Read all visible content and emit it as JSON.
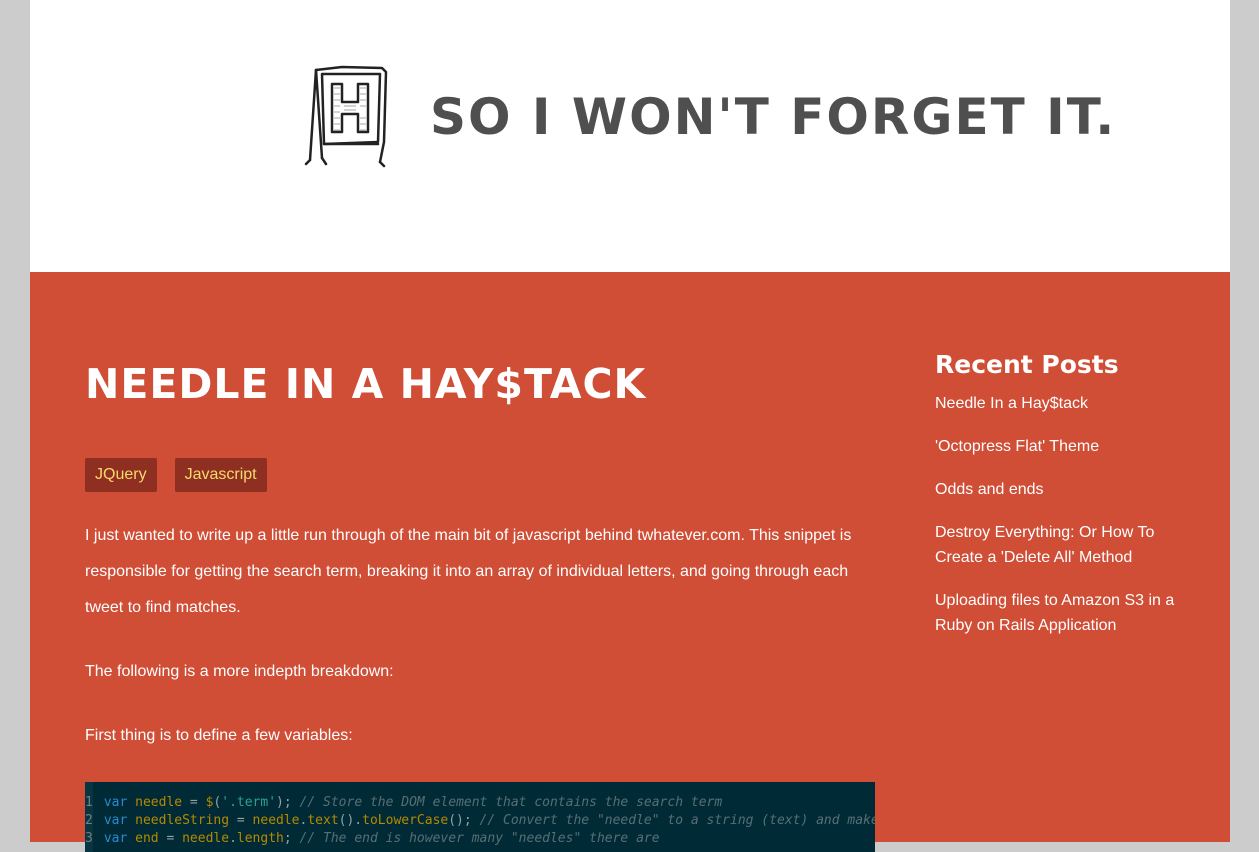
{
  "header": {
    "tagline": "So I won't forget it.",
    "logo_icon": "easel-h-logo-icon"
  },
  "post": {
    "title": "Needle In a Hay$tack",
    "tags": [
      "JQuery",
      "Javascript"
    ],
    "paragraphs": [
      "I just wanted to write up a little run through of the main bit of javascript behind twhatever.com. This snippet is responsible for getting the search term, breaking it into an array of individual letters, and going through each tweet to find matches.",
      "The following is a more indepth breakdown:",
      "First thing is to define a few variables:"
    ],
    "code": {
      "line_numbers": [
        "1",
        "2",
        "3"
      ]
    }
  },
  "sidebar": {
    "heading": "Recent Posts",
    "links": [
      "Needle In a Hay$tack",
      "'Octopress Flat' Theme",
      "Odds and ends",
      "Destroy Everything: Or How To Create a 'Delete All' Method",
      "Uploading files to Amazon S3 in a Ruby on Rails Application"
    ]
  },
  "colors": {
    "background": "#cccccc",
    "header_bg": "#ffffff",
    "accent_red": "#d04d36",
    "tag_bg": "#8e2f22",
    "tag_text": "#f6da6a",
    "code_bg": "#002b36"
  }
}
